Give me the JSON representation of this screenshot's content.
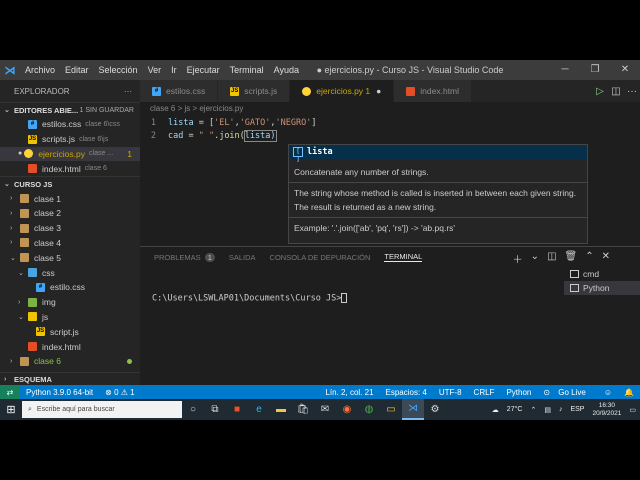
{
  "window": {
    "title": "● ejercicios.py - Curso JS - Visual Studio Code",
    "menu": [
      "Archivo",
      "Editar",
      "Selección",
      "Ver",
      "Ir",
      "Ejecutar",
      "Terminal",
      "Ayuda"
    ]
  },
  "sidebar": {
    "header": "EXPLORADOR",
    "open_editors": {
      "title": "EDITORES ABIE...",
      "unsaved": "1 SIN GUARDAR",
      "files": [
        {
          "name": "estilos.css",
          "path": "clase 6\\css"
        },
        {
          "name": "scripts.js",
          "path": "clase 6\\js"
        },
        {
          "name": "ejercicios.py",
          "path": "clase ...",
          "count": "1"
        },
        {
          "name": "index.html",
          "path": "clase 6"
        }
      ]
    },
    "workspace": {
      "title": "CURSO JS",
      "items": [
        "clase 1",
        "clase 2",
        "clase 3",
        "clase 4",
        "clase 5",
        "css",
        "estilo.css",
        "img",
        "js",
        "script.js",
        "index.html",
        "clase 6"
      ]
    },
    "outline": "ESQUEMA"
  },
  "tabs": [
    {
      "label": "estilos.css"
    },
    {
      "label": "scripts.js"
    },
    {
      "label": "ejercicios.py 1"
    },
    {
      "label": "index.html"
    }
  ],
  "breadcrumb": "clase 6 > js > ejercicios.py",
  "editor": {
    "lines": [
      {
        "num": "1",
        "var": "lista",
        "rest": " = [",
        "s1": "'EL'",
        "s2": "'GATO'",
        "s3": "'NEGRO'",
        "end": "]"
      },
      {
        "num": "2",
        "var": "cad",
        "rest": " = ",
        "s1": "\" \"",
        "fn": ".join(",
        "arg": "lista)"
      }
    ]
  },
  "suggest": {
    "name": "lista",
    "line1": "Concatenate any number of strings.",
    "line2": "The string whose method is called is inserted in between each given string. The result is returned as a new string.",
    "line3": "Example: '.'.join(['ab', 'pq', 'rs']) -> 'ab.pq.rs'"
  },
  "panel": {
    "tabs": [
      "PROBLEMAS",
      "SALIDA",
      "CONSOLA DE DEPURACIÓN",
      "TERMINAL"
    ],
    "problems_count": "1",
    "terminals": [
      "cmd",
      "Python"
    ],
    "prompt": "C:\\Users\\LSWLAP01\\Documents\\Curso JS>"
  },
  "status": {
    "python": "Python 3.9.0 64-bit",
    "errors": "⊗ 0 ⚠ 1",
    "position": "Lín. 2, col. 21",
    "spaces": "Espacios: 4",
    "encoding": "UTF-8",
    "eol": "CRLF",
    "lang": "Python",
    "golive": "Go Live"
  },
  "taskbar": {
    "search_placeholder": "Escribe aquí para buscar",
    "temp": "27°C",
    "lang": "ESP",
    "time": "16:30",
    "date": "20/9/2021"
  }
}
